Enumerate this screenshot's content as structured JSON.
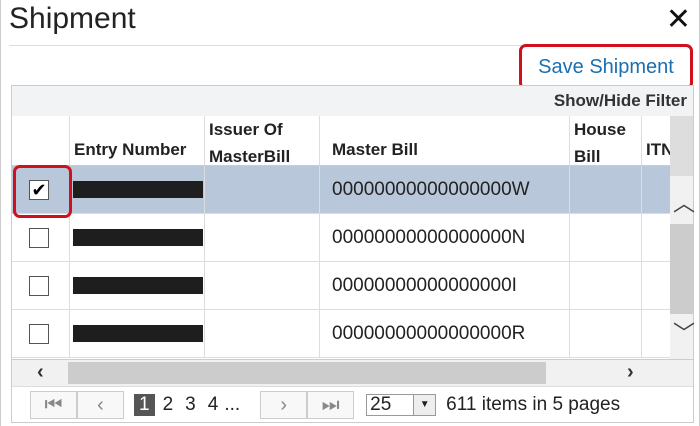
{
  "dialog": {
    "title": "Shipment",
    "close_icon": "close-icon"
  },
  "toolbar": {
    "save_label": "Save Shipment"
  },
  "grid": {
    "filter_label": "Show/Hide Filter",
    "columns": [
      {
        "l1": "",
        "l2": ""
      },
      {
        "l1": "",
        "l2": "Entry Number"
      },
      {
        "l1": "Issuer Of",
        "l2": "MasterBill"
      },
      {
        "l1": "",
        "l2": "Master Bill"
      },
      {
        "l1": "House",
        "l2": "Bill"
      },
      {
        "l1": "",
        "l2": "ITN"
      }
    ],
    "rows": [
      {
        "checked": true,
        "master_bill": "00000000000000000W",
        "check": "✔"
      },
      {
        "checked": false,
        "master_bill": "00000000000000000N",
        "check": ""
      },
      {
        "checked": false,
        "master_bill": "00000000000000000I",
        "check": ""
      },
      {
        "checked": false,
        "master_bill": "00000000000000000R",
        "check": ""
      }
    ],
    "selected_row_color": "#b8c7da"
  },
  "pager": {
    "pages": [
      "1",
      "2",
      "3",
      "4",
      "..."
    ],
    "current": "1",
    "page_size": "25",
    "summary": "611 items in 5 pages"
  }
}
